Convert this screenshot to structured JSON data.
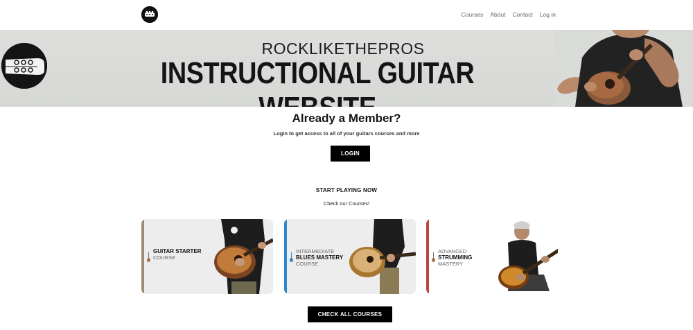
{
  "nav": {
    "items": [
      "Courses",
      "About",
      "Contact",
      "Log in"
    ]
  },
  "hero": {
    "brand": "ROCKLIKETHEPROS",
    "title": "INSTRUCTIONAL GUITAR WEBSITE"
  },
  "member": {
    "title": "Already a Member?",
    "subtitle": "Login to get access to all of your guitars courses and more",
    "login_label": "LOGIN"
  },
  "start": {
    "title": "START PLAYING NOW",
    "subtitle": "Check our Courses!"
  },
  "courses": [
    {
      "top": "",
      "main": "GUITAR STARTER",
      "bottom": "COURSE",
      "accent": "#a08b78"
    },
    {
      "top": "INTERMEDIATE",
      "main": "BLUES MASTERY",
      "bottom": "COURSE",
      "accent": "#2f86c8"
    },
    {
      "top": "ADVANCED",
      "main": "STRUMMING",
      "bottom": "MASTERY",
      "accent": "#b8453e"
    }
  ],
  "check_all_label": "CHECK ALL COURSES",
  "colors": {
    "banner_bg": "#d9dbd8",
    "button_bg": "#000000",
    "text_dark": "#111111"
  },
  "icons": {
    "logo": "guitar-headstock-logo",
    "course_marker": "guitar-icon"
  }
}
